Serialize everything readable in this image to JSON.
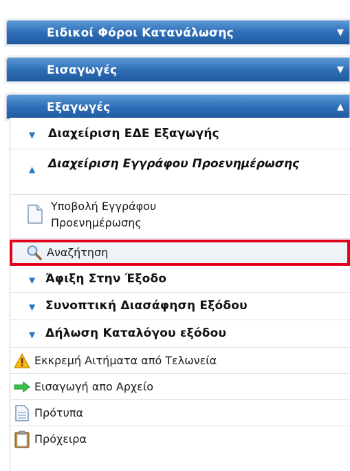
{
  "panels": [
    {
      "title": "Ειδικοί Φόροι Κατανάλωσης",
      "expanded": false
    },
    {
      "title": "Εισαγωγές",
      "expanded": false
    },
    {
      "title": "Εξαγωγές",
      "expanded": true
    }
  ],
  "export_menu": {
    "groups": [
      {
        "label": "Διαχείριση ΕΔΕ Εξαγωγής"
      },
      {
        "label": "Διαχείριση Εγγράφου Προενημέρωσης"
      }
    ],
    "sub_items": [
      {
        "label_line1": "Υποβολή Εγγράφου",
        "label_line2": "Προενημέρωσης",
        "icon": "document-icon"
      },
      {
        "label": "Αναζήτηση",
        "icon": "magnifier-icon",
        "selected": true
      }
    ],
    "more_groups": [
      {
        "label": "Άφιξη Στην Έξοδο"
      },
      {
        "label": "Συνοπτική Διασάφηση Εξόδου"
      },
      {
        "label": "Δήλωση Καταλόγου εξόδου"
      }
    ],
    "links": [
      {
        "label": "Εκκρεμή Αιτήματα από Τελωνεία",
        "icon": "warning-icon"
      },
      {
        "label": "Εισαγωγή απο Αρχείο",
        "icon": "green-arrow-icon"
      },
      {
        "label": "Πρότυπα",
        "icon": "document-icon"
      },
      {
        "label": "Πρόχειρα",
        "icon": "clipboard-icon"
      }
    ]
  },
  "colors": {
    "header": "#2f6fb7",
    "selection_border": "#e3001b",
    "caret": "#2c79c7"
  }
}
